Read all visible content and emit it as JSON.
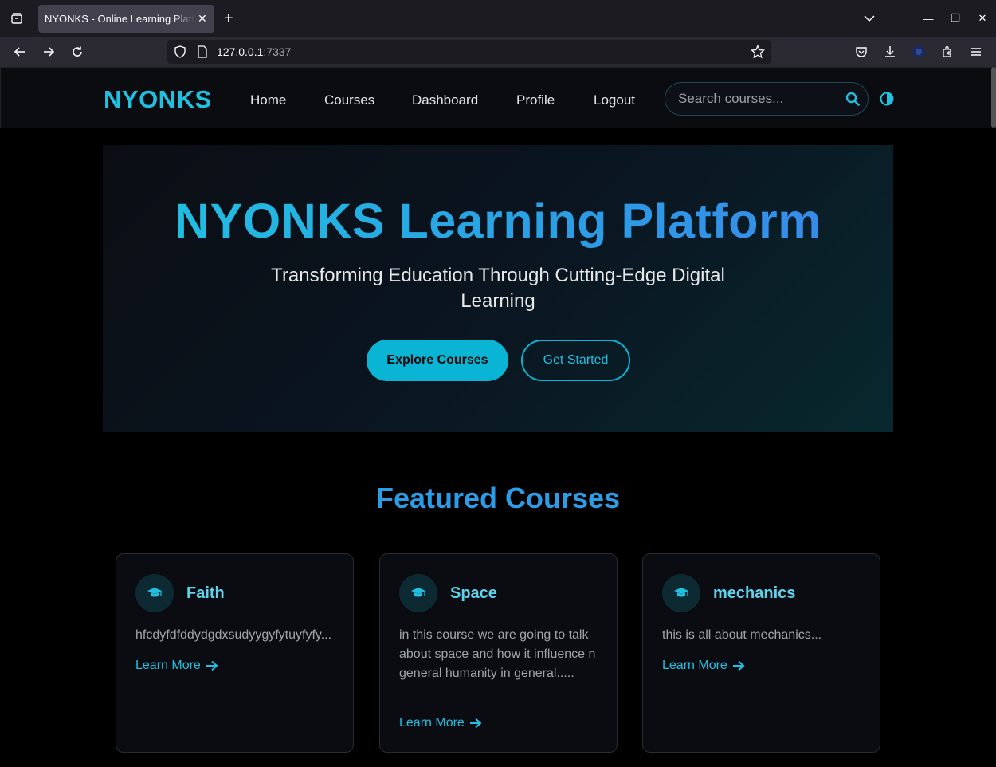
{
  "browser": {
    "tab_title": "NYONKS - Online Learning Platform",
    "url_host": "127.0.0.1",
    "url_port": ":7337"
  },
  "site": {
    "logo": "NYONKS",
    "nav": [
      "Home",
      "Courses",
      "Dashboard",
      "Profile",
      "Logout"
    ],
    "search_placeholder": "Search courses..."
  },
  "hero": {
    "title": "NYONKS Learning Platform",
    "subtitle": "Transforming Education Through Cutting-Edge Digital Learning",
    "primary_button": "Explore Courses",
    "secondary_button": "Get Started"
  },
  "featured": {
    "title": "Featured Courses",
    "courses": [
      {
        "title": "Faith",
        "description": "hfcdyfdfddydgdxsudyygyfytuyfyfy...",
        "link": "Learn More"
      },
      {
        "title": "Space",
        "description": "in this course we are going to talk about space and how it influence n general humanity in general.....",
        "link": "Learn More"
      },
      {
        "title": "mechanics",
        "description": "this is all about mechanics...",
        "link": "Learn More"
      }
    ]
  },
  "colors": {
    "accent": "#22c0e0",
    "accent_blue": "#2b9de6",
    "background": "#000000"
  }
}
